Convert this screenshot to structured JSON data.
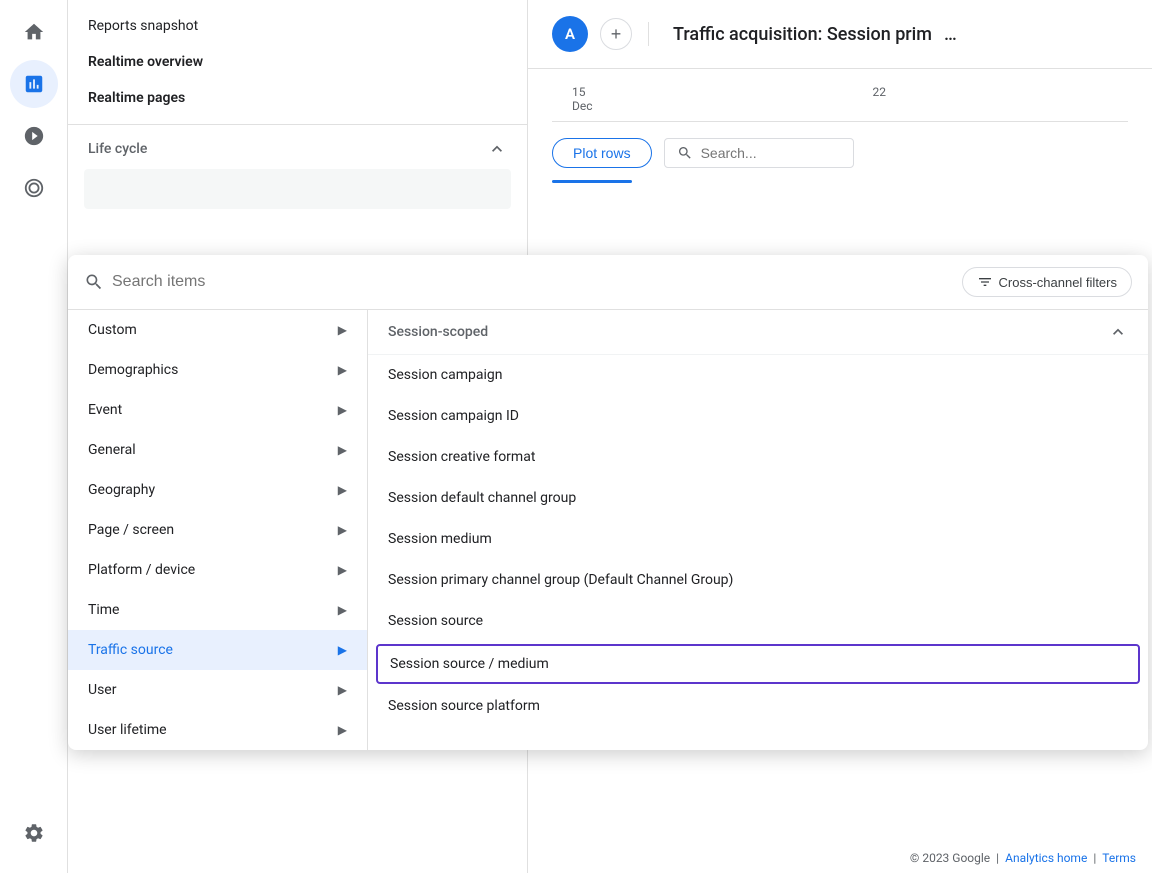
{
  "nav": {
    "icons": [
      {
        "name": "home-icon",
        "symbol": "⌂",
        "active": false
      },
      {
        "name": "bar-chart-icon",
        "symbol": "▦",
        "active": true
      },
      {
        "name": "activity-icon",
        "symbol": "◎",
        "active": false
      },
      {
        "name": "target-icon",
        "symbol": "⊕",
        "active": false
      },
      {
        "name": "settings-icon",
        "symbol": "⚙",
        "active": false
      }
    ]
  },
  "sidebar": {
    "nav_items": [
      {
        "label": "Reports snapshot",
        "bold": false
      },
      {
        "label": "Realtime overview",
        "bold": true
      },
      {
        "label": "Realtime pages",
        "bold": true
      }
    ],
    "sections": [
      {
        "label": "Life cycle",
        "expanded": true
      }
    ]
  },
  "dropdown": {
    "search_placeholder": "Search items",
    "cross_channel_label": "Cross-channel filters",
    "left_items": [
      {
        "label": "Custom",
        "has_submenu": true,
        "active": false
      },
      {
        "label": "Demographics",
        "has_submenu": true,
        "active": false
      },
      {
        "label": "Event",
        "has_submenu": true,
        "active": false
      },
      {
        "label": "General",
        "has_submenu": true,
        "active": false
      },
      {
        "label": "Geography",
        "has_submenu": true,
        "active": false
      },
      {
        "label": "Page / screen",
        "has_submenu": true,
        "active": false
      },
      {
        "label": "Platform / device",
        "has_submenu": true,
        "active": false
      },
      {
        "label": "Time",
        "has_submenu": true,
        "active": false
      },
      {
        "label": "Traffic source",
        "has_submenu": true,
        "active": true
      },
      {
        "label": "User",
        "has_submenu": true,
        "active": false
      },
      {
        "label": "User lifetime",
        "has_submenu": true,
        "active": false
      }
    ],
    "right_section_label": "Session-scoped",
    "right_items": [
      {
        "label": "Session campaign",
        "selected": false
      },
      {
        "label": "Session campaign ID",
        "selected": false
      },
      {
        "label": "Session creative format",
        "selected": false
      },
      {
        "label": "Session default channel group",
        "selected": false
      },
      {
        "label": "Session medium",
        "selected": false
      },
      {
        "label": "Session primary channel group (Default Channel Group)",
        "selected": false
      },
      {
        "label": "Session source",
        "selected": false
      },
      {
        "label": "Session source / medium",
        "selected": true
      },
      {
        "label": "Session source platform",
        "selected": false
      }
    ]
  },
  "main": {
    "avatar_letter": "A",
    "title": "Traffic acquisition: Session prim",
    "date_labels": [
      "15\nDec",
      "22"
    ],
    "plot_rows_label": "Plot rows",
    "search_placeholder": "Search..."
  },
  "footer": {
    "copyright": "© 2023 Google",
    "links": [
      {
        "label": "Analytics home"
      },
      {
        "label": "Terms"
      }
    ]
  }
}
